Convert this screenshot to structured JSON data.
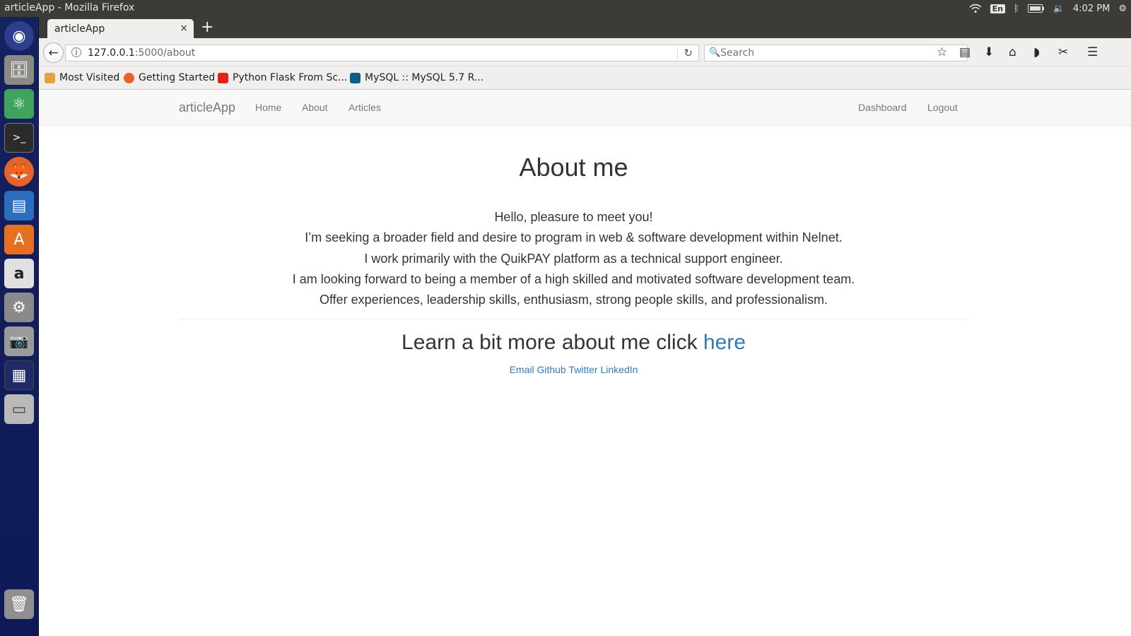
{
  "os": {
    "window_title": "articleApp - Mozilla Firefox",
    "input_indicator": "En",
    "clock": "4:02 PM"
  },
  "browser": {
    "tab_title": "articleApp",
    "tab_close": "×",
    "new_tab": "+",
    "url_host": "127.0.0.1",
    "url_path": ":5000/about",
    "search_placeholder": "Search",
    "bookmarks": [
      "Most Visited",
      "Getting Started",
      "Python Flask From Sc...",
      "MySQL :: MySQL 5.7 R..."
    ]
  },
  "site": {
    "brand": "articleApp",
    "nav_left": [
      "Home",
      "About",
      "Articles"
    ],
    "nav_right": [
      "Dashboard",
      "Logout"
    ],
    "heading": "About me",
    "paragraph_lines": [
      "Hello, pleasure to meet you!",
      "I’m seeking a broader field and desire to program in web & software development within Nelnet.",
      "I work primarily with the QuikPAY platform as a technical support engineer.",
      "I am looking forward to being a member of a high skilled and motivated software development team.",
      "Offer experiences, leadership skills, enthusiasm, strong people skills, and professionalism."
    ],
    "learn_more_text": "Learn a bit more about me click",
    "learn_more_link": "here",
    "social_links": [
      "Email",
      "Github",
      "Twitter",
      "LinkedIn"
    ]
  },
  "colors": {
    "link": "#337ab7",
    "launcher_bg": "#16225e",
    "topbar_bg": "#3c3b37"
  }
}
